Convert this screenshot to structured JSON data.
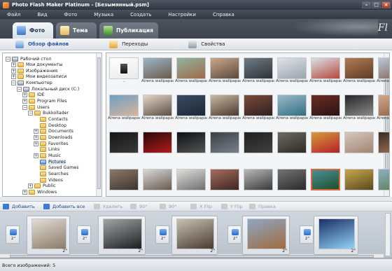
{
  "window": {
    "title": "Photo Flash Maker Platinum - [Безымянный.psm]"
  },
  "menu": [
    "Файл",
    "Вид",
    "Фото",
    "Музыка",
    "Создать",
    "Настройки",
    "Справка"
  ],
  "tabs": [
    {
      "label": "Фото"
    },
    {
      "label": "Тема"
    },
    {
      "label": "Публикация"
    }
  ],
  "subtoolbar": [
    "Обзор файлов",
    "Переходы",
    "Свойства"
  ],
  "tree": [
    {
      "label": "Рабочий стол",
      "depth": 0,
      "exp": "−",
      "icon": "d"
    },
    {
      "label": "Мои документы",
      "depth": 1,
      "exp": "+",
      "icon": "y"
    },
    {
      "label": "Изображения",
      "depth": 1,
      "exp": "+",
      "icon": "y"
    },
    {
      "label": "Мои видеозаписи",
      "depth": 1,
      "exp": "+",
      "icon": "y"
    },
    {
      "label": "Компьютер",
      "depth": 1,
      "exp": "−",
      "icon": "d"
    },
    {
      "label": "Локальный диск (C:)",
      "depth": 2,
      "exp": "−",
      "icon": "d"
    },
    {
      "label": "IDE",
      "depth": 3,
      "exp": "+",
      "icon": "y"
    },
    {
      "label": "Program Files",
      "depth": 3,
      "exp": "+",
      "icon": "y"
    },
    {
      "label": "Users",
      "depth": 3,
      "exp": "−",
      "icon": "y"
    },
    {
      "label": "Bukkollader",
      "depth": 4,
      "exp": "−",
      "icon": "y"
    },
    {
      "label": "Contacts",
      "depth": 5,
      "exp": "",
      "icon": "y"
    },
    {
      "label": "Desktop",
      "depth": 5,
      "exp": "",
      "icon": "y"
    },
    {
      "label": "Documents",
      "depth": 5,
      "exp": "+",
      "icon": "y"
    },
    {
      "label": "Downloads",
      "depth": 5,
      "exp": "+",
      "icon": "y"
    },
    {
      "label": "Favorites",
      "depth": 5,
      "exp": "+",
      "icon": "y"
    },
    {
      "label": "Links",
      "depth": 5,
      "exp": "",
      "icon": "y"
    },
    {
      "label": "Music",
      "depth": 5,
      "exp": "+",
      "icon": "y"
    },
    {
      "label": "Pictures",
      "depth": 5,
      "exp": "",
      "icon": "s",
      "selected": true
    },
    {
      "label": "Saved Games",
      "depth": 5,
      "exp": "",
      "icon": "y"
    },
    {
      "label": "Searches",
      "depth": 5,
      "exp": "",
      "icon": "y"
    },
    {
      "label": "Videos",
      "depth": 5,
      "exp": "",
      "icon": "y"
    },
    {
      "label": "Public",
      "depth": 4,
      "exp": "+",
      "icon": "y"
    },
    {
      "label": "Windows",
      "depth": 3,
      "exp": "+",
      "icon": "y"
    }
  ],
  "grid": {
    "rows": [
      [
        {
          "cap": "..",
          "c1": "#ffffff",
          "c2": "#e9e9e9",
          "up": true
        },
        {
          "cap": "Airena wallpapac...",
          "c1": "#9bb6c7",
          "c2": "#6b5a4a"
        },
        {
          "cap": "Airena wallpapac...",
          "c1": "#8fb3a0",
          "c2": "#a06a48"
        },
        {
          "cap": "Airena wallpapac...",
          "c1": "#caa78a",
          "c2": "#5a4a3e"
        },
        {
          "cap": "Airena wallpapac...",
          "c1": "#6f7c86",
          "c2": "#2e3236"
        },
        {
          "cap": "Airena wallpapac...",
          "c1": "#dfe3e8",
          "c2": "#9aa3ab"
        },
        {
          "cap": "Airena wallpapac...",
          "c1": "#d9e0e6",
          "c2": "#b7483c"
        },
        {
          "cap": "Airena wallpapac...",
          "c1": "#b17c52",
          "c2": "#5d3b28"
        },
        {
          "cap": "Airena wallpapac...",
          "c1": "#bcc9d6",
          "c2": "#806058"
        }
      ],
      [
        {
          "cap": "Airena wallpapac...",
          "c1": "#6f9fc6",
          "c2": "#d8b49a"
        },
        {
          "cap": "Airena wallpapac...",
          "c1": "#e1d6c5",
          "c2": "#5b4f46"
        },
        {
          "cap": "Airena wallpapac...",
          "c1": "#3a4b63",
          "c2": "#1e2835"
        },
        {
          "cap": "Airena wallpapac...",
          "c1": "#c7b9a2",
          "c2": "#4a3a30"
        },
        {
          "cap": "Airena wallpapac...",
          "c1": "#7a4b3a",
          "c2": "#2f2020"
        },
        {
          "cap": "Airena wallpapac...",
          "c1": "#9db8c6",
          "c2": "#2f6f84"
        },
        {
          "cap": "Airena wallpapac...",
          "c1": "#6d2c25",
          "c2": "#2a1414"
        },
        {
          "cap": "Airena wallpapac...",
          "c1": "#262626",
          "c2": "#8a8a8a"
        },
        {
          "cap": "Airena wallpapac...",
          "c1": "#d2a98a",
          "c2": "#8a5b3c"
        }
      ],
      [
        {
          "cap": "",
          "c1": "#151515",
          "c2": "#3a3a3a"
        },
        {
          "cap": "",
          "c1": "#2a0808",
          "c2": "#b21c1c"
        },
        {
          "cap": "",
          "c1": "#0d0f12",
          "c2": "#555"
        },
        {
          "cap": "",
          "c1": "#3a3f45",
          "c2": "#7a8088"
        },
        {
          "cap": "",
          "c1": "#1f1f1f",
          "c2": "#404040"
        },
        {
          "cap": "",
          "c1": "#6e6a62",
          "c2": "#2e2a26"
        },
        {
          "cap": "",
          "c1": "#d89c3c",
          "c2": "#b32028"
        },
        {
          "cap": "",
          "c1": "#d6c7bc",
          "c2": "#9f8573"
        },
        {
          "cap": "",
          "c1": "#3a2a22",
          "c2": "#a67a5c"
        }
      ],
      [
        {
          "cap": "",
          "c1": "#8b7a6a",
          "c2": "#3d342d"
        },
        {
          "cap": "",
          "c1": "#d8d8d8",
          "c2": "#6a5a50"
        },
        {
          "cap": "",
          "c1": "#e0ded9",
          "c2": "#707070"
        },
        {
          "cap": "",
          "c1": "#a86c5c",
          "c2": "#3d2522"
        },
        {
          "cap": "",
          "c1": "#b8b8b8",
          "c2": "#3a3a3a"
        },
        {
          "cap": "",
          "c1": "#737373",
          "c2": "#2a2a2a"
        },
        {
          "cap": "",
          "c1": "#4a8f98",
          "c2": "#1e4f2c",
          "selected": true
        },
        {
          "cap": "",
          "c1": "#c9a54d",
          "c2": "#5a4a1e"
        },
        {
          "cap": "",
          "c1": "#8cb1c6",
          "c2": "#5a7a4a"
        }
      ]
    ]
  },
  "actions": [
    {
      "label": "Добавить",
      "disabled": false,
      "c": "#3a7bd5"
    },
    {
      "label": "Добавить все",
      "disabled": false,
      "c": "#3a7bd5"
    },
    {
      "label": "Удалить",
      "disabled": true,
      "c": "#c8ccd0"
    },
    {
      "label": "90°",
      "disabled": true,
      "c": "#c8ccd0"
    },
    {
      "label": "90°",
      "disabled": true,
      "c": "#c8ccd0"
    },
    {
      "label": "X Flip",
      "disabled": true,
      "c": "#c8ccd0"
    },
    {
      "label": "Y Flip",
      "disabled": true,
      "c": "#c8ccd0"
    },
    {
      "label": "Правка",
      "disabled": true,
      "c": "#c8ccd0"
    }
  ],
  "filmstrip": {
    "transitions": [
      {
        "dur": "2\""
      },
      {
        "dur": "2\""
      },
      {
        "dur": "2\""
      },
      {
        "dur": "2\""
      },
      {
        "dur": "2\""
      }
    ],
    "slides": [
      {
        "dur": "2\"",
        "c1": "#e2ddd4",
        "c2": "#8a7a68"
      },
      {
        "dur": "2\"",
        "c1": "#a0a4a8",
        "c2": "#1e1e1e"
      },
      {
        "dur": "2\"",
        "c1": "#c7c1b3",
        "c2": "#4a3a2f"
      },
      {
        "dur": "2\"",
        "c1": "#8fa7c3",
        "c2": "#a06a3e"
      },
      {
        "dur": "2\"",
        "c1": "#1c2f66",
        "c2": "#8fd3f5"
      }
    ]
  },
  "status": {
    "text": "Всего изображений: 5"
  }
}
